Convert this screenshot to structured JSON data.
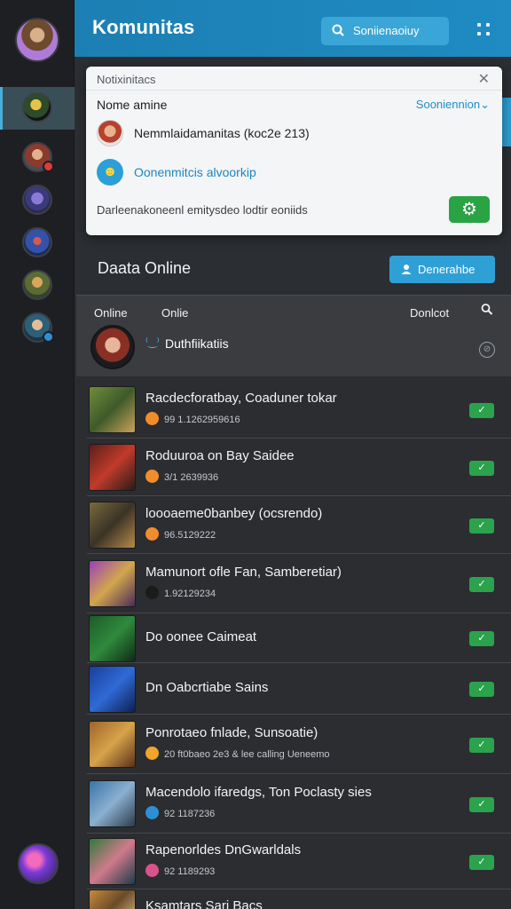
{
  "header": {
    "title": "Komunitas",
    "search_label": "Soniienaoiuy"
  },
  "notification": {
    "title": "Notixinitacs",
    "label": "Nome amine",
    "dropdown": "Sooniennion",
    "row1": "Nemmlaidamanitas (koc2e 213)",
    "row2": "Oonenmitcis alvoorkip",
    "footer": "Darleenakoneenl emitysdeo lodtir eoniids"
  },
  "section": {
    "title": "Daata Online",
    "button_label": "Denerahbe"
  },
  "list_header": {
    "col1": "Online",
    "col2": "Onlie",
    "col3": "Donlcot",
    "featured_name": "Duthfiikatiis"
  },
  "games": [
    {
      "title": "Racdecforatbay, Coaduner tokar",
      "sub": "99 1.1262959616",
      "emoji": "#f08c2b"
    },
    {
      "title": "Roduuroa on Bay Saidee",
      "sub": "3/1 2639936",
      "emoji": "#f08c2b"
    },
    {
      "title": "loooaeme0banbey (ocsrendo)",
      "sub": "96.5129222",
      "emoji": "#f08c2b"
    },
    {
      "title": "Mamunort ofle Fan, Samberetiar)",
      "sub": "1.92129234",
      "emoji": "#1b1b1b"
    },
    {
      "title": "Do oonee Caimeat",
      "sub": "",
      "emoji": ""
    },
    {
      "title": "Dn Oabcrtiabe Sains",
      "sub": "",
      "emoji": ""
    },
    {
      "title": "Ponrotaeo fnlade, Sunsoatie)",
      "sub": "20 ft0baeo 2e3 & lee calling Ueneemo",
      "emoji": "#f0a52b"
    },
    {
      "title": "Macendolo ifaredgs, Ton Poclasty sies",
      "sub": "92 1187236",
      "emoji": "#2f8fd6"
    },
    {
      "title": "Rapenorldes DnGwarldals",
      "sub": "92 1189293",
      "emoji": "#d9538a"
    },
    {
      "title": "Ksamtars Sari Bacs",
      "sub": "",
      "emoji": ""
    }
  ],
  "colors": {
    "header_blue": "#1f8bc2",
    "accent_blue": "#2fa0d6",
    "check_green": "#2ba24c",
    "background": "#2b2e33"
  },
  "icons": {
    "search": "search-icon",
    "grid": "grid-icon",
    "close": "close-icon",
    "settings": "gear-icon",
    "check": "check-icon"
  }
}
